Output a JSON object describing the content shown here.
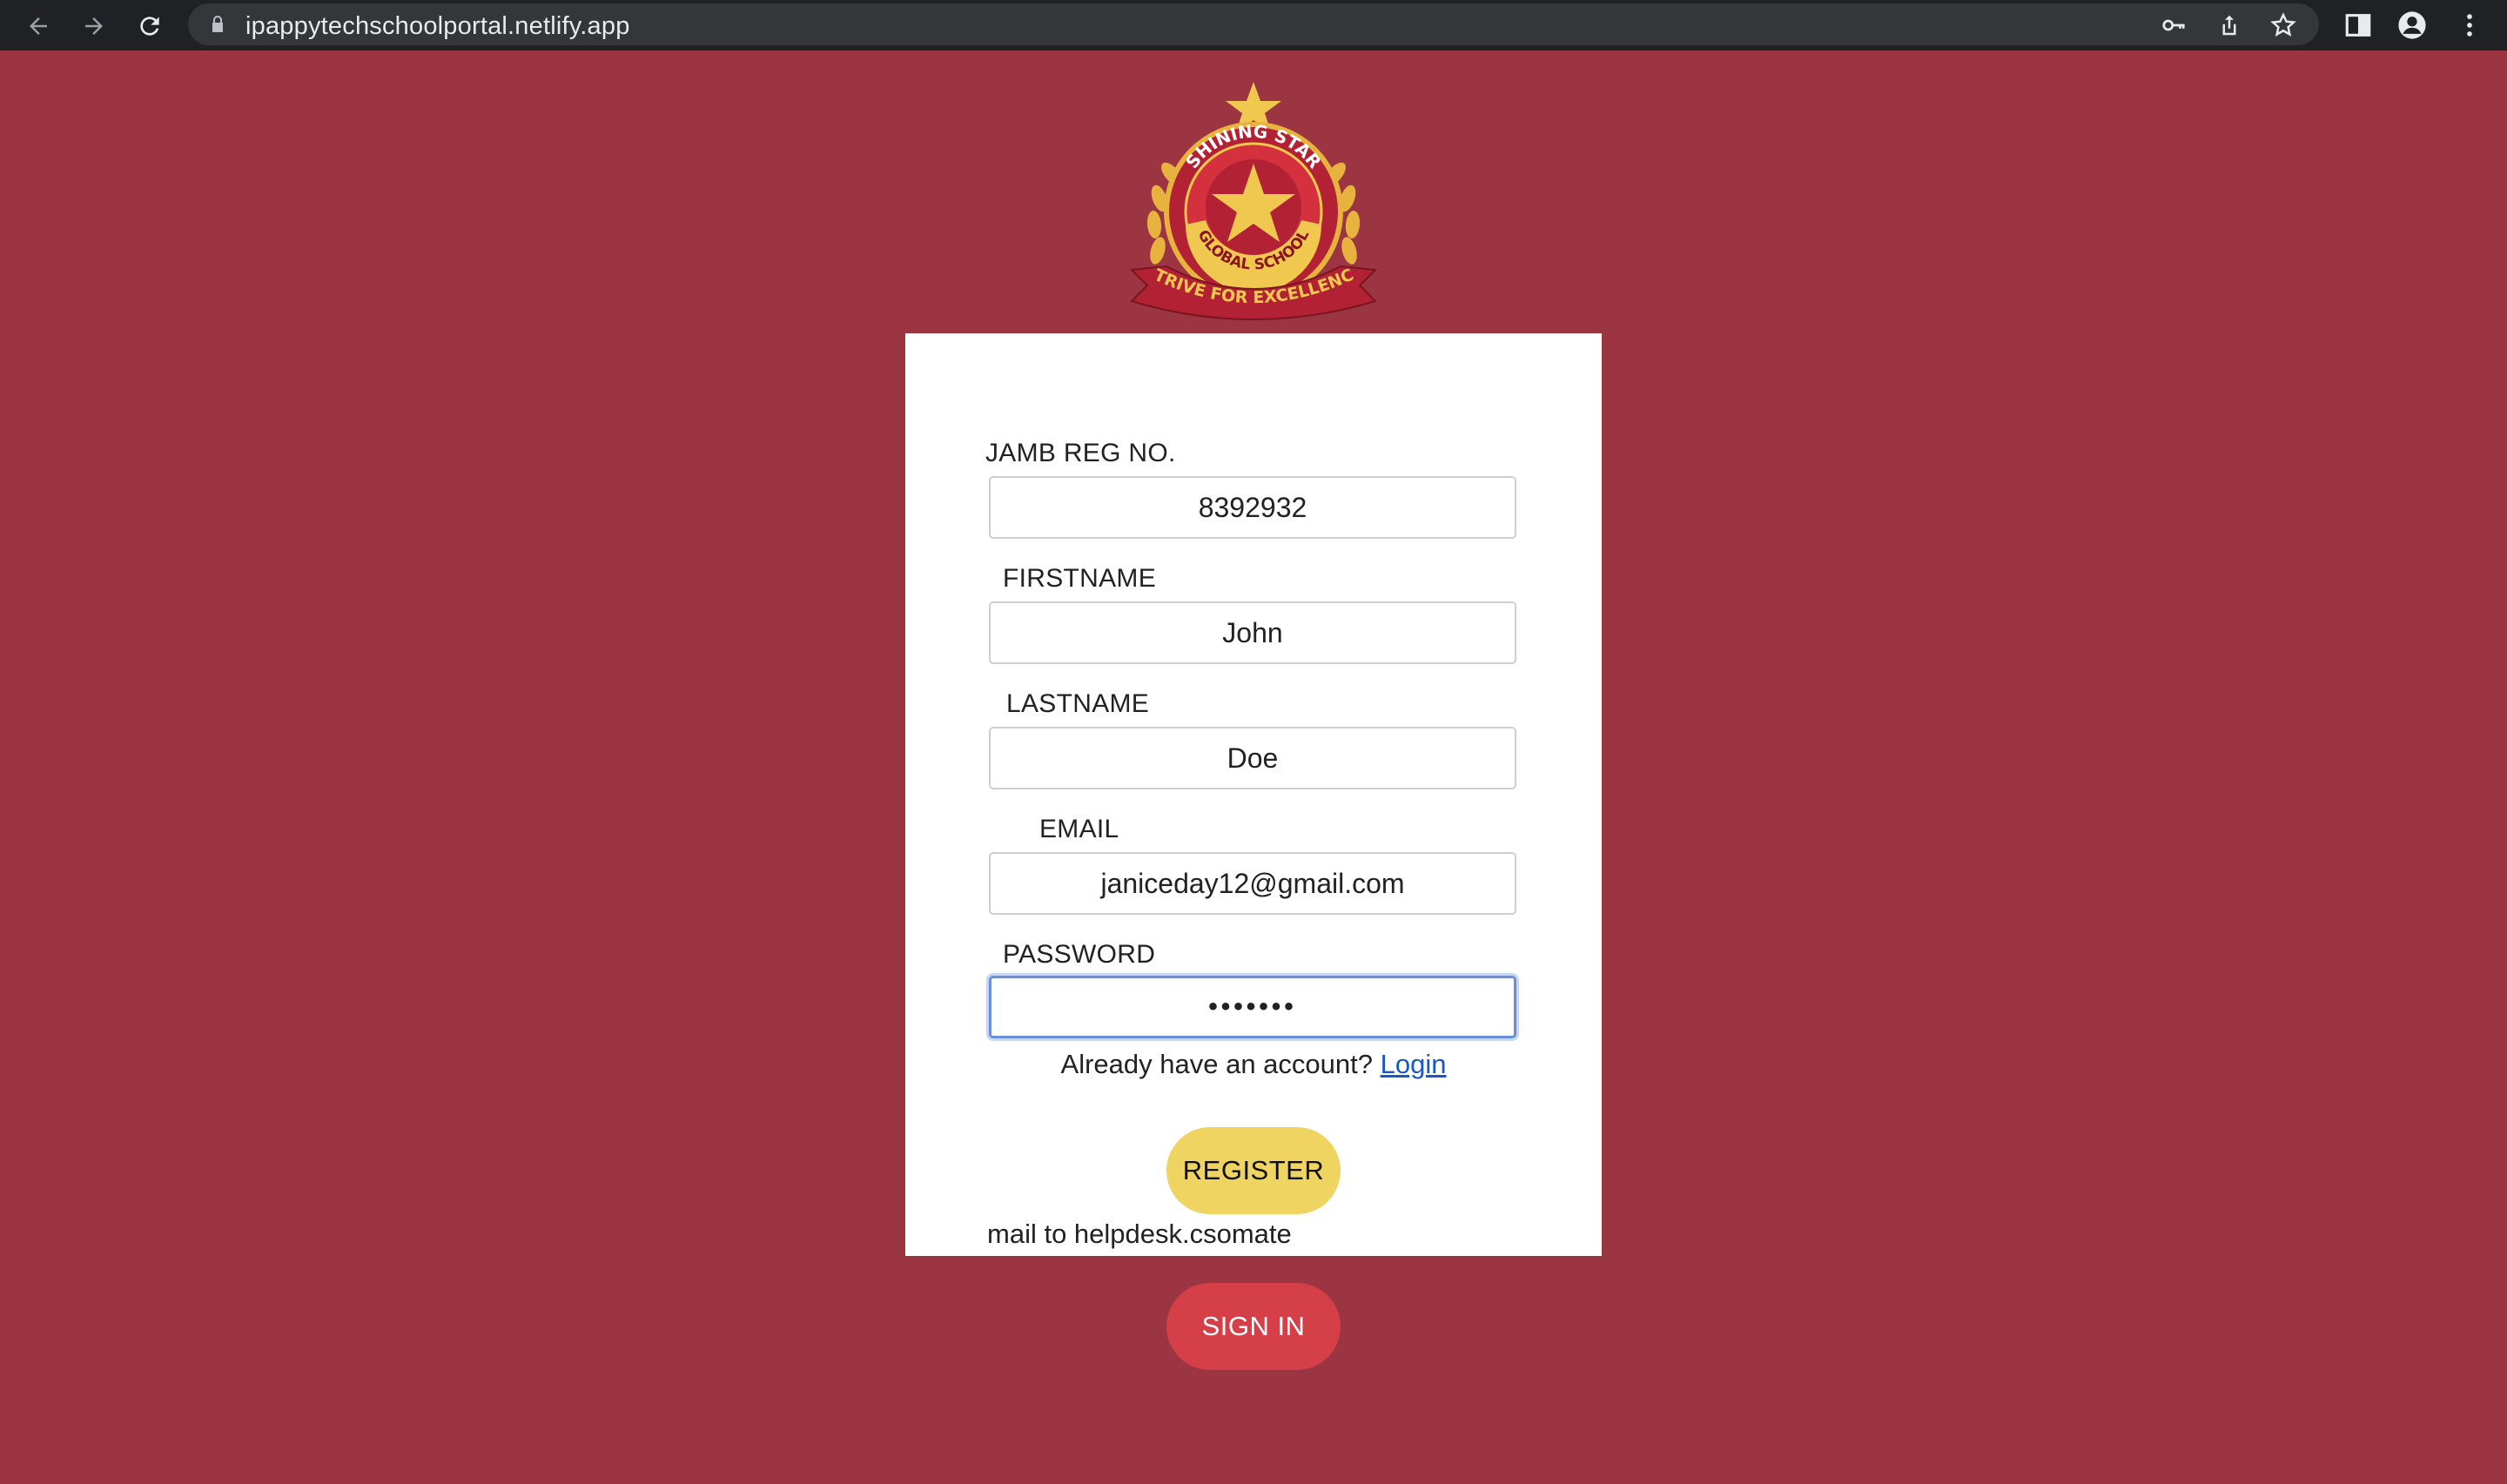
{
  "browser": {
    "url": "ipappytechschoolportal.netlify.app",
    "back_icon": "arrow-left-icon",
    "forward_icon": "arrow-right-icon",
    "reload_icon": "reload-icon"
  },
  "logo": {
    "top_text": "SHINING STAR",
    "middle_text": "GLOBAL SCHOOL",
    "ribbon_text": "STRIVE FOR EXCELLENCE"
  },
  "form": {
    "jamb": {
      "label": "JAMB REG NO.",
      "value": "8392932"
    },
    "firstname": {
      "label": "FIRSTNAME",
      "value": "John"
    },
    "lastname": {
      "label": "LASTNAME",
      "value": "Doe"
    },
    "email": {
      "label": "EMAIL",
      "value": "janiceday12@gmail.com"
    },
    "password": {
      "label": "PASSWORD",
      "value": "•••••••"
    },
    "already_text": "Already have an account?",
    "login_link": "Login",
    "register_label": "REGISTER",
    "mail_text": "mail to helpdesk.csomate"
  },
  "signin_label": "SIGN IN",
  "colors": {
    "page_bg": "#9b3541",
    "register_btn": "#efd462",
    "signin_btn": "#d43f48",
    "link": "#1a56c4"
  }
}
